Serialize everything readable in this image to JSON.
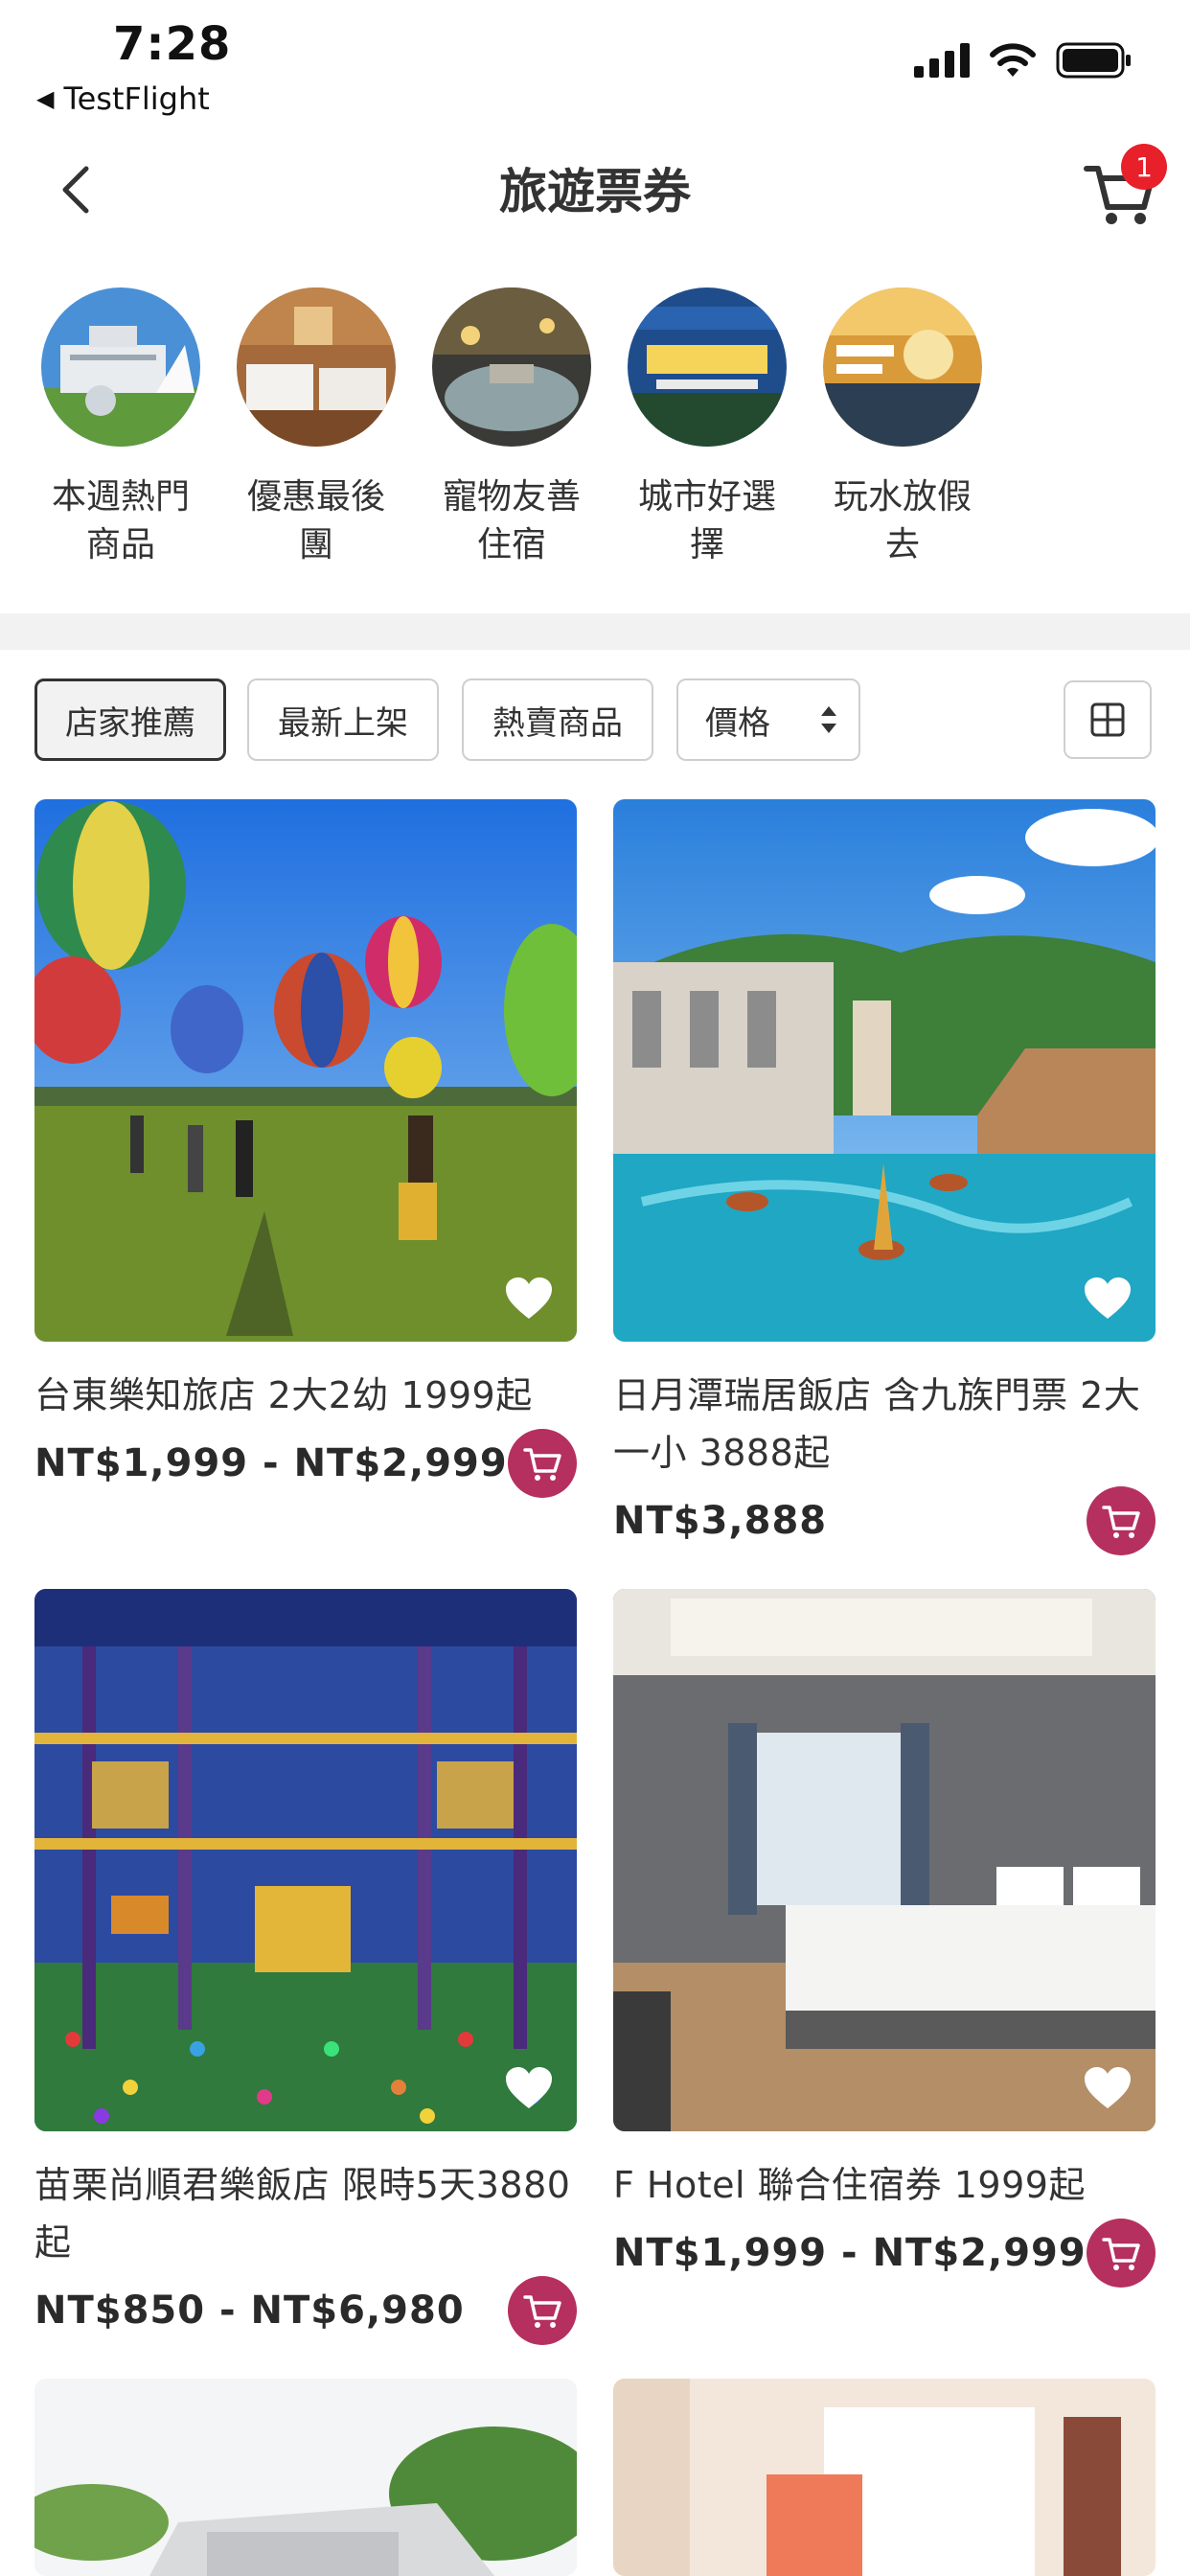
{
  "status_bar": {
    "time": "7:28",
    "back_app_label": "TestFlight",
    "icons": [
      "signal-icon",
      "wifi-icon",
      "battery-icon"
    ]
  },
  "nav": {
    "title": "旅遊票券",
    "cart_badge": "1",
    "icons": [
      "chevron-left-icon",
      "cart-icon"
    ]
  },
  "categories": [
    {
      "label": "本週熱門商品"
    },
    {
      "label": "優惠最後團"
    },
    {
      "label": "寵物友善住宿"
    },
    {
      "label": "城市好選擇"
    },
    {
      "label": "玩水放假去"
    }
  ],
  "filters": {
    "items": [
      {
        "label": "店家推薦",
        "active": true
      },
      {
        "label": "最新上架",
        "active": false
      },
      {
        "label": "熱賣商品",
        "active": false
      },
      {
        "label": "價格",
        "active": false
      }
    ],
    "grid_toggle_icon": "grid-icon"
  },
  "products": [
    {
      "title": "台東樂知旅店 2大2幼 1999起",
      "price": "NT$1,999 - NT$2,999"
    },
    {
      "title": "日月潭瑞居飯店 含九族門票 2大一小 3888起",
      "price": "NT$3,888"
    },
    {
      "title": "苗栗尚順君樂飯店 限時5天3880起",
      "price": "NT$850 - NT$6,980"
    },
    {
      "title": "F Hotel 聯合住宿券 1999起",
      "price": "NT$1,999 - NT$2,999"
    }
  ],
  "colors": {
    "cart_button": "#b52f5f",
    "badge": "#e8202a",
    "divider": "#f2f2f2"
  }
}
